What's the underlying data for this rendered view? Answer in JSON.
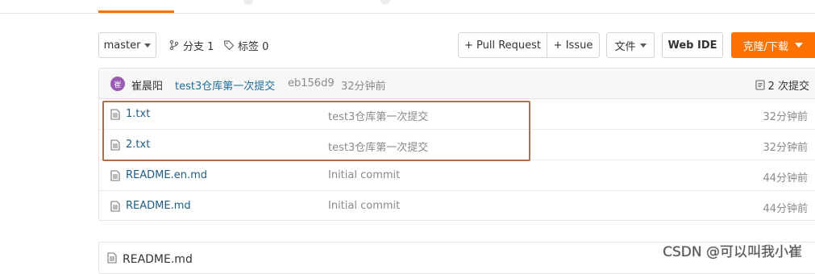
{
  "toolbar": {
    "branch_label": "master",
    "branches_label": "分支 1",
    "tags_label": "标签 0",
    "pull_request_label": "+ Pull Request",
    "issue_label": "+ Issue",
    "file_label": "文件",
    "web_ide_label": "Web IDE",
    "clone_label": "克隆/下载",
    "accent_color": "#fe7300"
  },
  "commit": {
    "avatar_letter": "崔",
    "author": "崔晨阳",
    "message": "test3仓库第一次提交",
    "hash": "eb156d9",
    "time": "32分钟前",
    "count_label": "2 次提交"
  },
  "files": [
    {
      "name": "1.txt",
      "message": "test3仓库第一次提交",
      "time": "32分钟前",
      "icon": "file-icon"
    },
    {
      "name": "2.txt",
      "message": "test3仓库第一次提交",
      "time": "32分钟前",
      "icon": "file-icon"
    },
    {
      "name": "README.en.md",
      "message": "Initial commit",
      "time": "44分钟前",
      "icon": "file-icon"
    },
    {
      "name": "README.md",
      "message": "Initial commit",
      "time": "44分钟前",
      "icon": "file-icon"
    }
  ],
  "readme": {
    "title": "README.md"
  },
  "watermark": "CSDN @可以叫我小崔"
}
